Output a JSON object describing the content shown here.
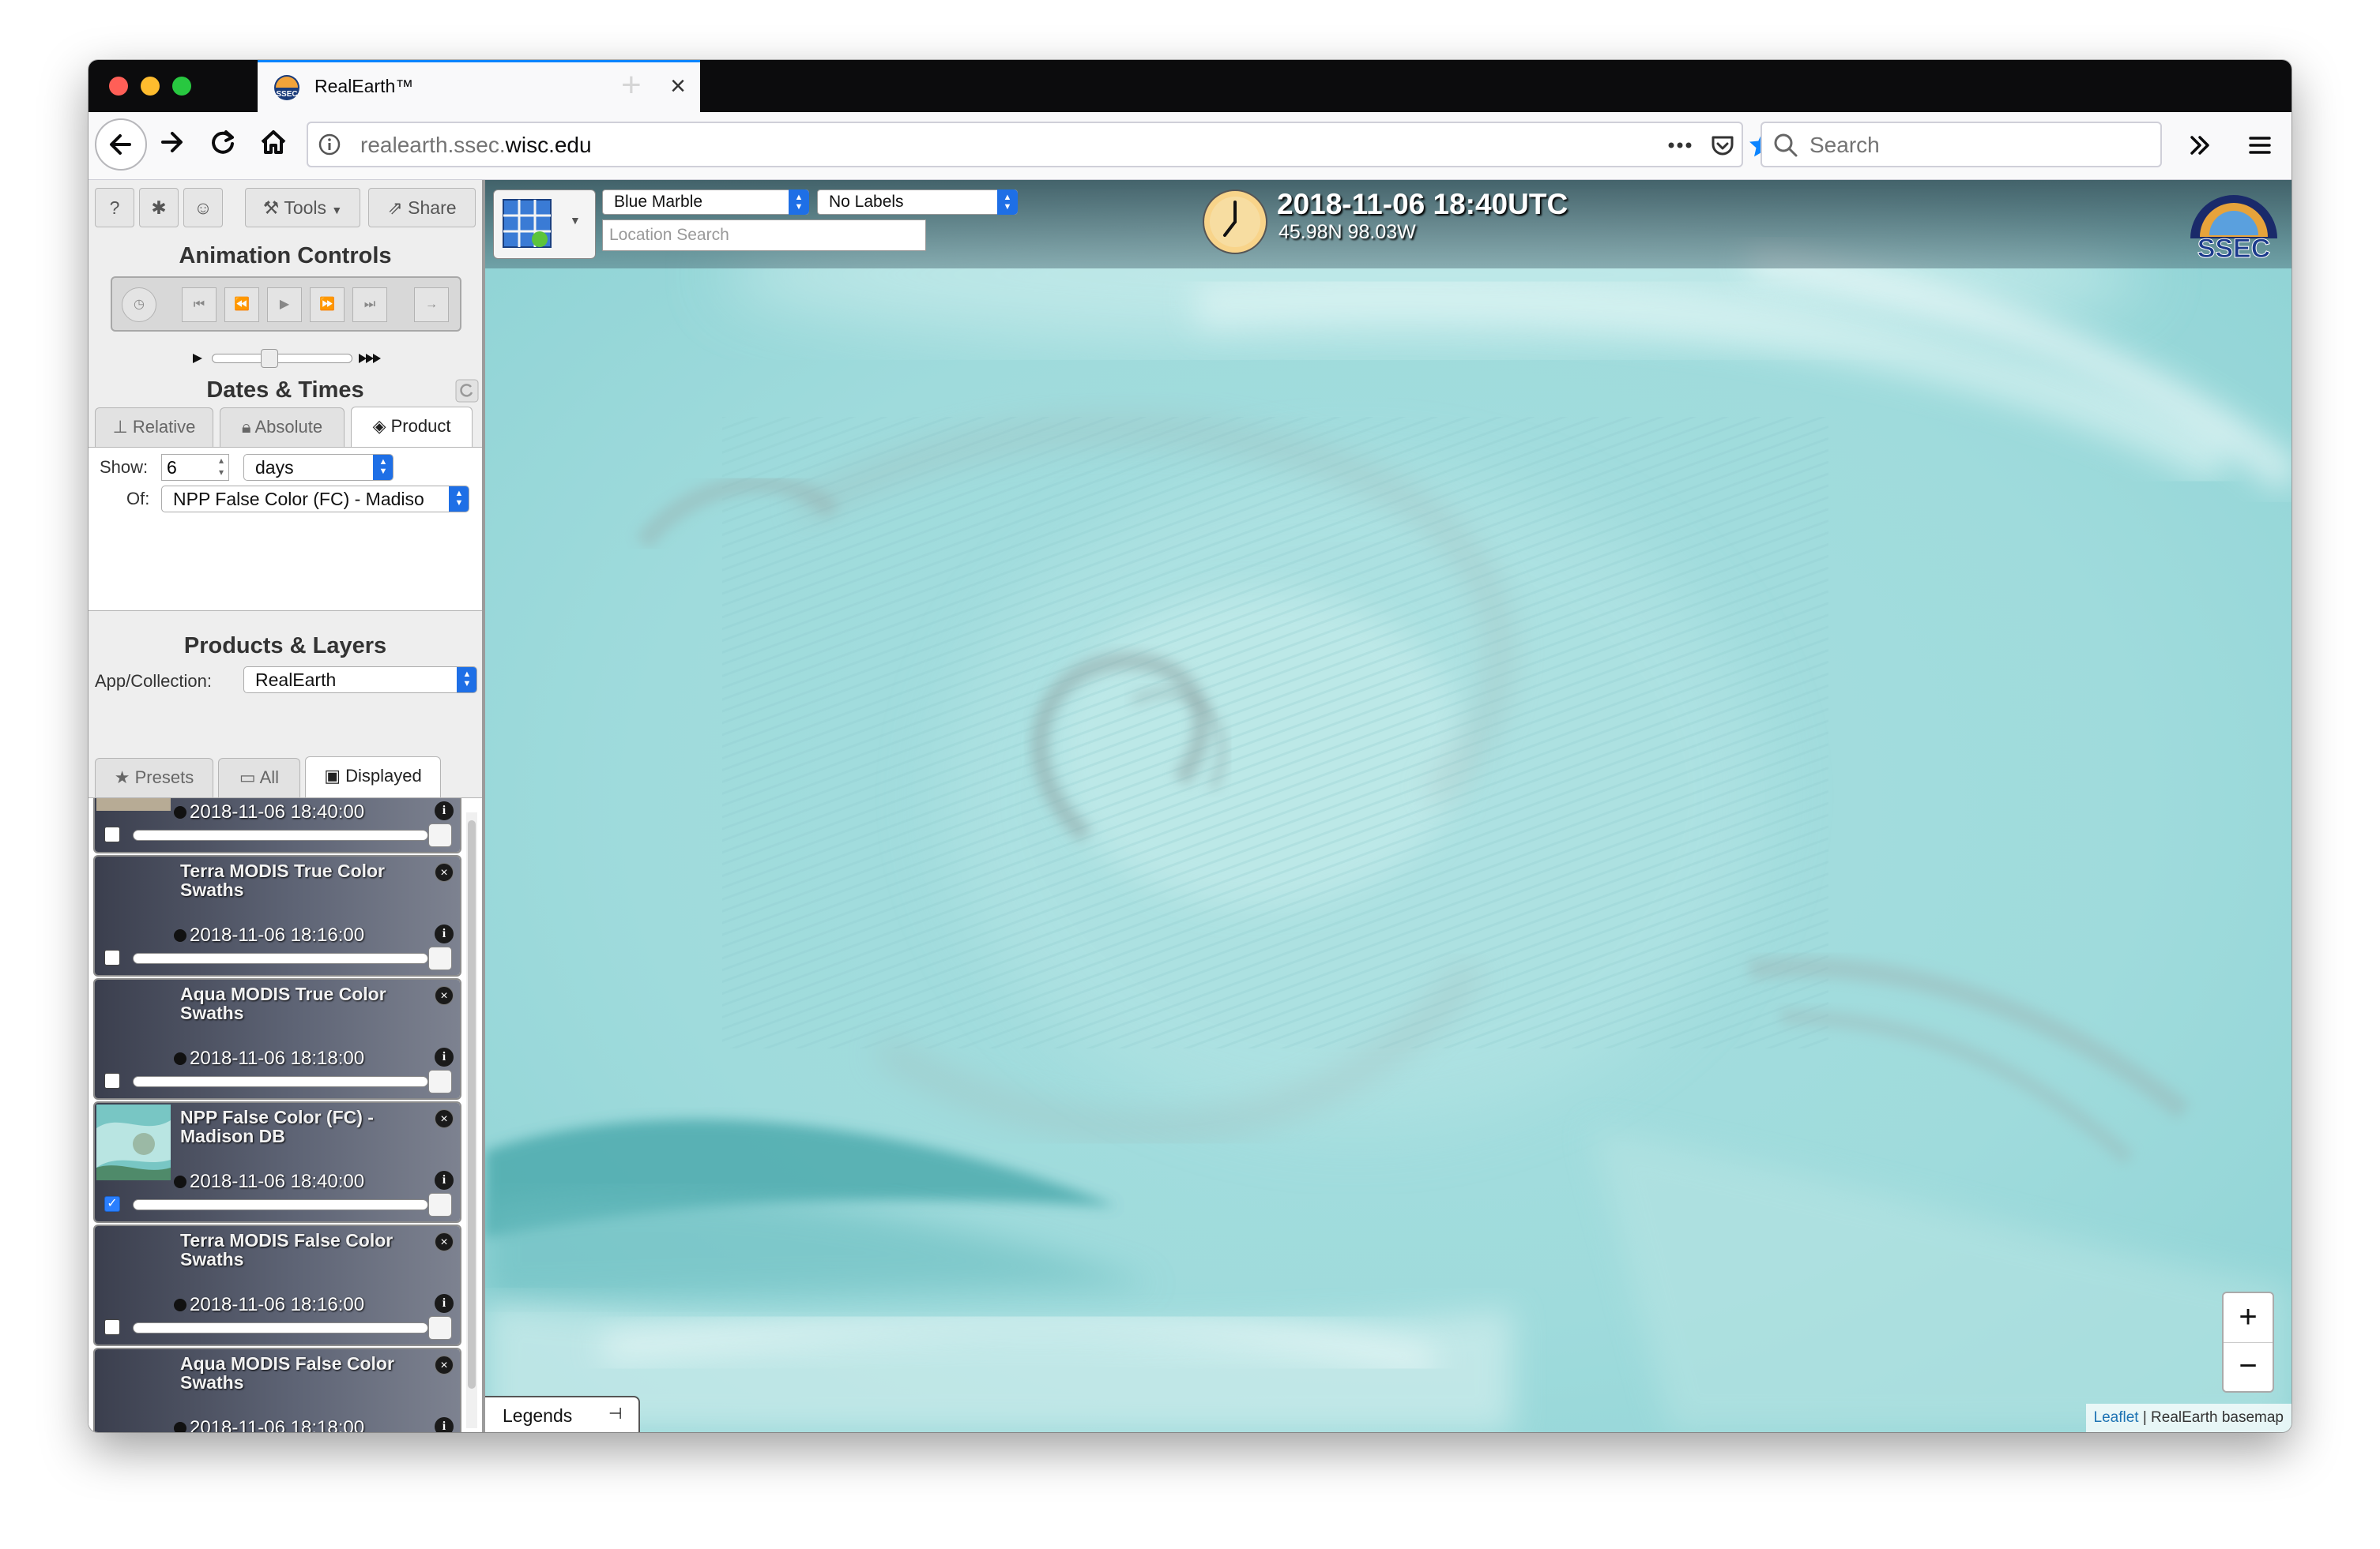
{
  "browser": {
    "tab_title": "RealEarth™",
    "url_host_prefix": "realearth.ssec.",
    "url_host_domain": "wisc.edu",
    "search_placeholder": "Search"
  },
  "sidebar": {
    "top_buttons": {
      "tools": "Tools",
      "share": "Share"
    },
    "animation": {
      "title": "Animation Controls"
    },
    "dates": {
      "title": "Dates & Times",
      "tabs": [
        "Relative",
        "Absolute",
        "Product"
      ],
      "active_tab": "Product",
      "show_label": "Show:",
      "show_value": "6",
      "unit": "days",
      "of_label": "Of:",
      "of_value": "NPP False Color (FC) - Madiso"
    },
    "products": {
      "title": "Products & Layers",
      "collection_label": "App/Collection:",
      "collection_value": "RealEarth",
      "tabs": [
        "Presets",
        "All",
        "Displayed"
      ],
      "active_tab": "Displayed"
    },
    "layers": [
      {
        "name": "",
        "time": "2018-11-06 18:40:00",
        "checked": false,
        "thumb": "terrain"
      },
      {
        "name": "Terra MODIS True Color Swaths",
        "time": "2018-11-06 18:16:00",
        "checked": false,
        "thumb": "none"
      },
      {
        "name": "Aqua MODIS True Color Swaths",
        "time": "2018-11-06 18:18:00",
        "checked": false,
        "thumb": "none"
      },
      {
        "name": "NPP False Color (FC) - Madison DB",
        "time": "2018-11-06 18:40:00",
        "checked": true,
        "thumb": "falsecolor"
      },
      {
        "name": "Terra MODIS False Color Swaths",
        "time": "2018-11-06 18:16:00",
        "checked": false,
        "thumb": "none"
      },
      {
        "name": "Aqua MODIS False Color Swaths",
        "time": "2018-11-06 18:18:00",
        "checked": false,
        "thumb": "none"
      }
    ]
  },
  "map": {
    "basemap": "Blue Marble",
    "labels": "No Labels",
    "location_placeholder": "Location Search",
    "datetime": "2018-11-06 18:40UTC",
    "coords": "45.98N 98.03W",
    "logo_text": "SSEC",
    "zoom_in": "+",
    "zoom_out": "−",
    "legends": "Legends",
    "attribution_link": "Leaflet",
    "attribution_text": " | RealEarth basemap"
  },
  "colors": {
    "accent": "#0a84ff",
    "select_arrow": "#1e6fe6",
    "cloud_cyan": "#a9e0e2"
  }
}
